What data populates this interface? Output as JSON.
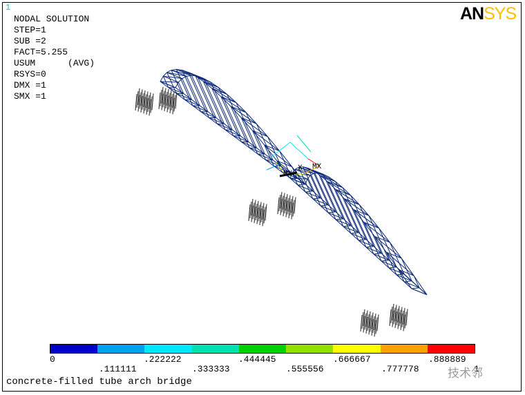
{
  "window_number": "1",
  "info_lines": [
    "NODAL SOLUTION",
    "",
    "STEP=1",
    "SUB =2",
    "FACT=5.255",
    "USUM      (AVG)",
    "RSYS=0",
    "DMX =1",
    "SMX =1"
  ],
  "logo": {
    "an": "AN",
    "sys": "SYS"
  },
  "markers": {
    "mx": "MX",
    "mn": "MN",
    "axis_x": "X"
  },
  "legend": {
    "colors": [
      "#0000c8",
      "#00a0f0",
      "#00e8ff",
      "#00e0b0",
      "#00d000",
      "#90e000",
      "#ffff00",
      "#ffa000",
      "#ff0000"
    ],
    "top_labels": [
      "0",
      ".222222",
      ".444445",
      ".666667",
      ".888889"
    ],
    "bottom_labels": [
      ".111111",
      ".333333",
      ".555556",
      ".777778",
      "1"
    ]
  },
  "caption": "concrete-filled tube arch bridge",
  "watermark": "技术邻"
}
